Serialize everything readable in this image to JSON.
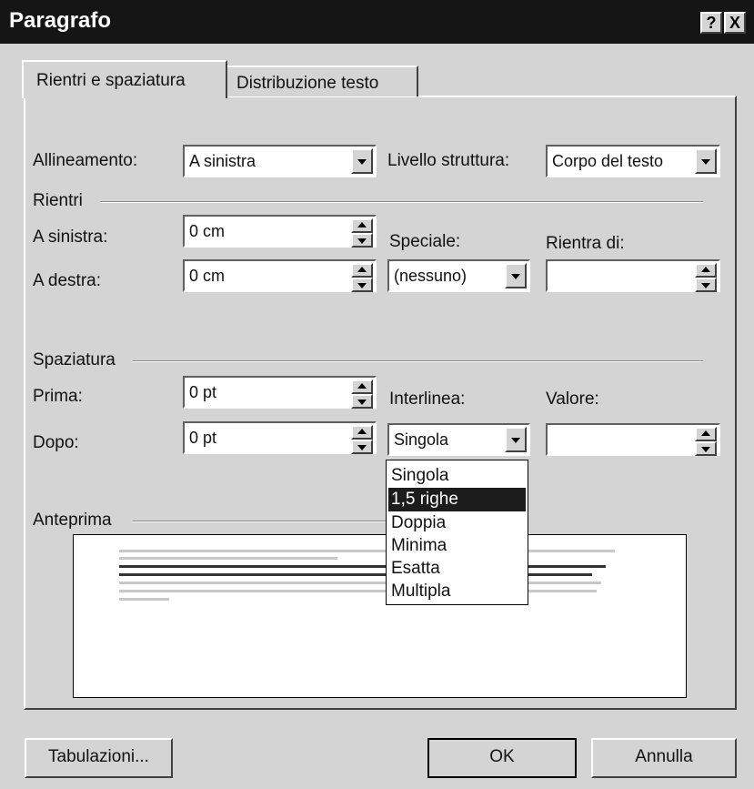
{
  "window": {
    "title": "Paragrafo",
    "help_label": "?",
    "close_label": "X"
  },
  "tabs": [
    {
      "label": "Rientri e spaziatura"
    },
    {
      "label": "Distribuzione testo"
    }
  ],
  "alignment": {
    "label": "Allineamento:",
    "value": "A sinistra"
  },
  "outline": {
    "label": "Livello struttura:",
    "value": "Corpo del testo"
  },
  "indent": {
    "group_label": "Rientri",
    "left_label": "A sinistra:",
    "left_value": "0 cm",
    "right_label": "A destra:",
    "right_value": "0 cm",
    "special_label": "Speciale:",
    "special_value": "(nessuno)",
    "by_label": "Rientra di:",
    "by_value": ""
  },
  "spacing": {
    "group_label": "Spaziatura",
    "before_label": "Prima:",
    "before_value": "0 pt",
    "after_label": "Dopo:",
    "after_value": "0 pt",
    "line_label": "Interlinea:",
    "line_value": "Singola",
    "at_label": "Valore:",
    "at_value": ""
  },
  "line_spacing_options": [
    {
      "label": "Singola",
      "selected": false
    },
    {
      "label": "1,5 righe",
      "selected": true
    },
    {
      "label": "Doppia",
      "selected": false
    },
    {
      "label": "Minima",
      "selected": false
    },
    {
      "label": "Esatta",
      "selected": false
    },
    {
      "label": "Multipla",
      "selected": false
    }
  ],
  "preview": {
    "group_label": "Anteprima"
  },
  "buttons": {
    "tabs_label": "Tabulazioni...",
    "ok_label": "OK",
    "cancel_label": "Annulla"
  },
  "colors": {
    "dialog_bg": "#d4d4d4",
    "title_bar": "#151515",
    "selection": "#1c1c1c"
  }
}
